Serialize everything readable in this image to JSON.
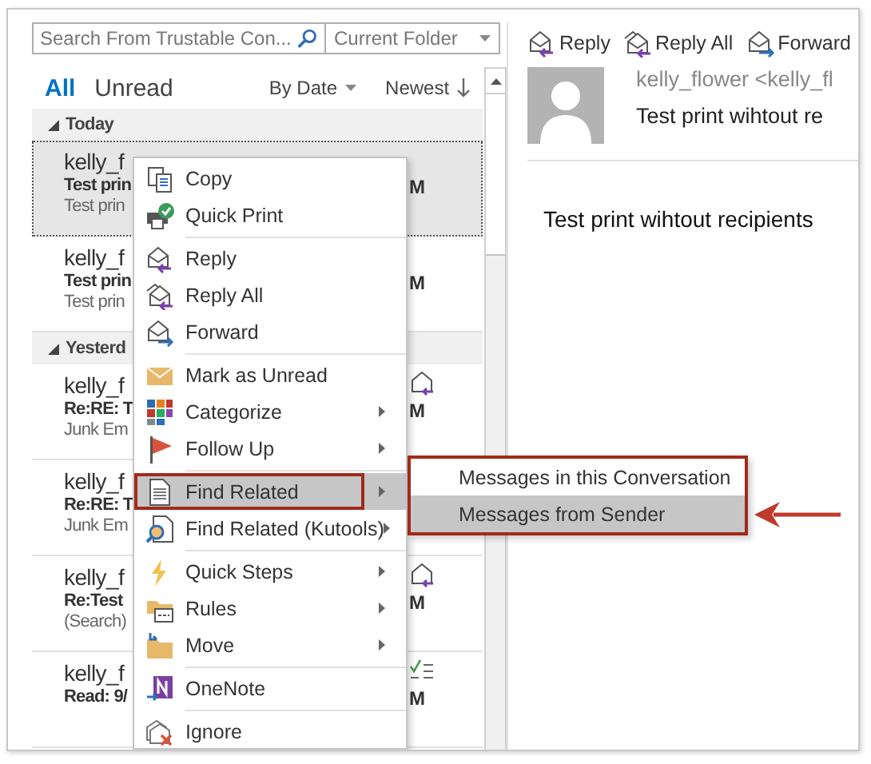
{
  "search": {
    "placeholder": "Search From Trustable Con...",
    "scope": "Current Folder"
  },
  "filters": [
    {
      "label": "All",
      "selected": true
    },
    {
      "label": "Unread",
      "selected": false
    }
  ],
  "sort": {
    "by": "By Date",
    "order": "Newest"
  },
  "groups": [
    {
      "label": "Today",
      "expanded": true,
      "messages": [
        {
          "sender": "kelly_f",
          "subject": "Test prin",
          "preview": "Test prin",
          "time": "M",
          "kind": "plain",
          "selected": true
        },
        {
          "sender": "kelly_f",
          "subject": "Test prin",
          "preview": "Test prin",
          "time": "M",
          "kind": "plain",
          "selected": false
        }
      ]
    },
    {
      "label": "Yesterd",
      "expanded": true,
      "messages": [
        {
          "sender": "kelly_f",
          "subject": "Re:RE: T",
          "preview": "Junk Em",
          "time": "M",
          "kind": "replied",
          "selected": false
        },
        {
          "sender": "kelly_f",
          "subject": "Re:RE: T",
          "preview": "Junk Em",
          "kind": "plain",
          "selected": false
        },
        {
          "sender": "kelly_f",
          "subject": "Re:Test",
          "preview": "(Search)",
          "time": "M",
          "kind": "replied",
          "selected": false
        },
        {
          "sender": "kelly_f",
          "subject": "Read: 9/",
          "time": "M",
          "kind": "receipt",
          "selected": false
        }
      ]
    }
  ],
  "context_menu": {
    "items": [
      {
        "kind": "copy",
        "label": "Copy",
        "has_submenu": false,
        "selected": false,
        "outlined": false
      },
      {
        "kind": "print",
        "label": "Quick Print",
        "has_submenu": false,
        "selected": false,
        "outlined": false
      },
      {
        "kind": "separator"
      },
      {
        "kind": "reply",
        "label": "Reply",
        "has_submenu": false,
        "selected": false,
        "outlined": false
      },
      {
        "kind": "replyall",
        "label": "Reply All",
        "has_submenu": false,
        "selected": false,
        "outlined": false
      },
      {
        "kind": "forward",
        "label": "Forward",
        "has_submenu": false,
        "selected": false,
        "outlined": false
      },
      {
        "kind": "separator"
      },
      {
        "kind": "envelope",
        "label": "Mark as Unread",
        "has_submenu": false,
        "selected": false,
        "outlined": false
      },
      {
        "kind": "tiles",
        "label": "Categorize",
        "has_submenu": true,
        "selected": false,
        "outlined": false
      },
      {
        "kind": "flag",
        "label": "Follow Up",
        "has_submenu": true,
        "selected": false,
        "outlined": false
      },
      {
        "kind": "separator"
      },
      {
        "kind": "document",
        "label": "Find Related",
        "has_submenu": true,
        "selected": true,
        "outlined": true,
        "submenu": {
          "outlined": true,
          "items": [
            {
              "label": "Messages in this Conversation",
              "selected": false
            },
            {
              "label": "Messages from Sender",
              "selected": true
            }
          ]
        }
      },
      {
        "kind": "lens",
        "label": "Find Related (Kutools)",
        "has_submenu": true,
        "selected": false,
        "outlined": false
      },
      {
        "kind": "separator"
      },
      {
        "kind": "bolt",
        "label": "Quick Steps",
        "has_submenu": true,
        "selected": false,
        "outlined": false
      },
      {
        "kind": "rules",
        "label": "Rules",
        "has_submenu": true,
        "selected": false,
        "outlined": false
      },
      {
        "kind": "folder",
        "label": "Move",
        "has_submenu": true,
        "selected": false,
        "outlined": false
      },
      {
        "kind": "separator"
      },
      {
        "kind": "note",
        "label": "OneNote",
        "has_submenu": false,
        "selected": false,
        "outlined": false
      },
      {
        "kind": "separator"
      },
      {
        "kind": "ignore",
        "label": "Ignore",
        "has_submenu": false,
        "selected": false,
        "outlined": false
      }
    ]
  },
  "reading_pane": {
    "actions": [
      {
        "kind": "reply",
        "label": "Reply"
      },
      {
        "kind": "replyall",
        "label": "Reply All"
      },
      {
        "kind": "forward",
        "label": "Forward"
      }
    ],
    "from": "kelly_flower <kelly_fl",
    "subject": "Test print wihtout re",
    "body": "Test print wihtout recipients"
  }
}
